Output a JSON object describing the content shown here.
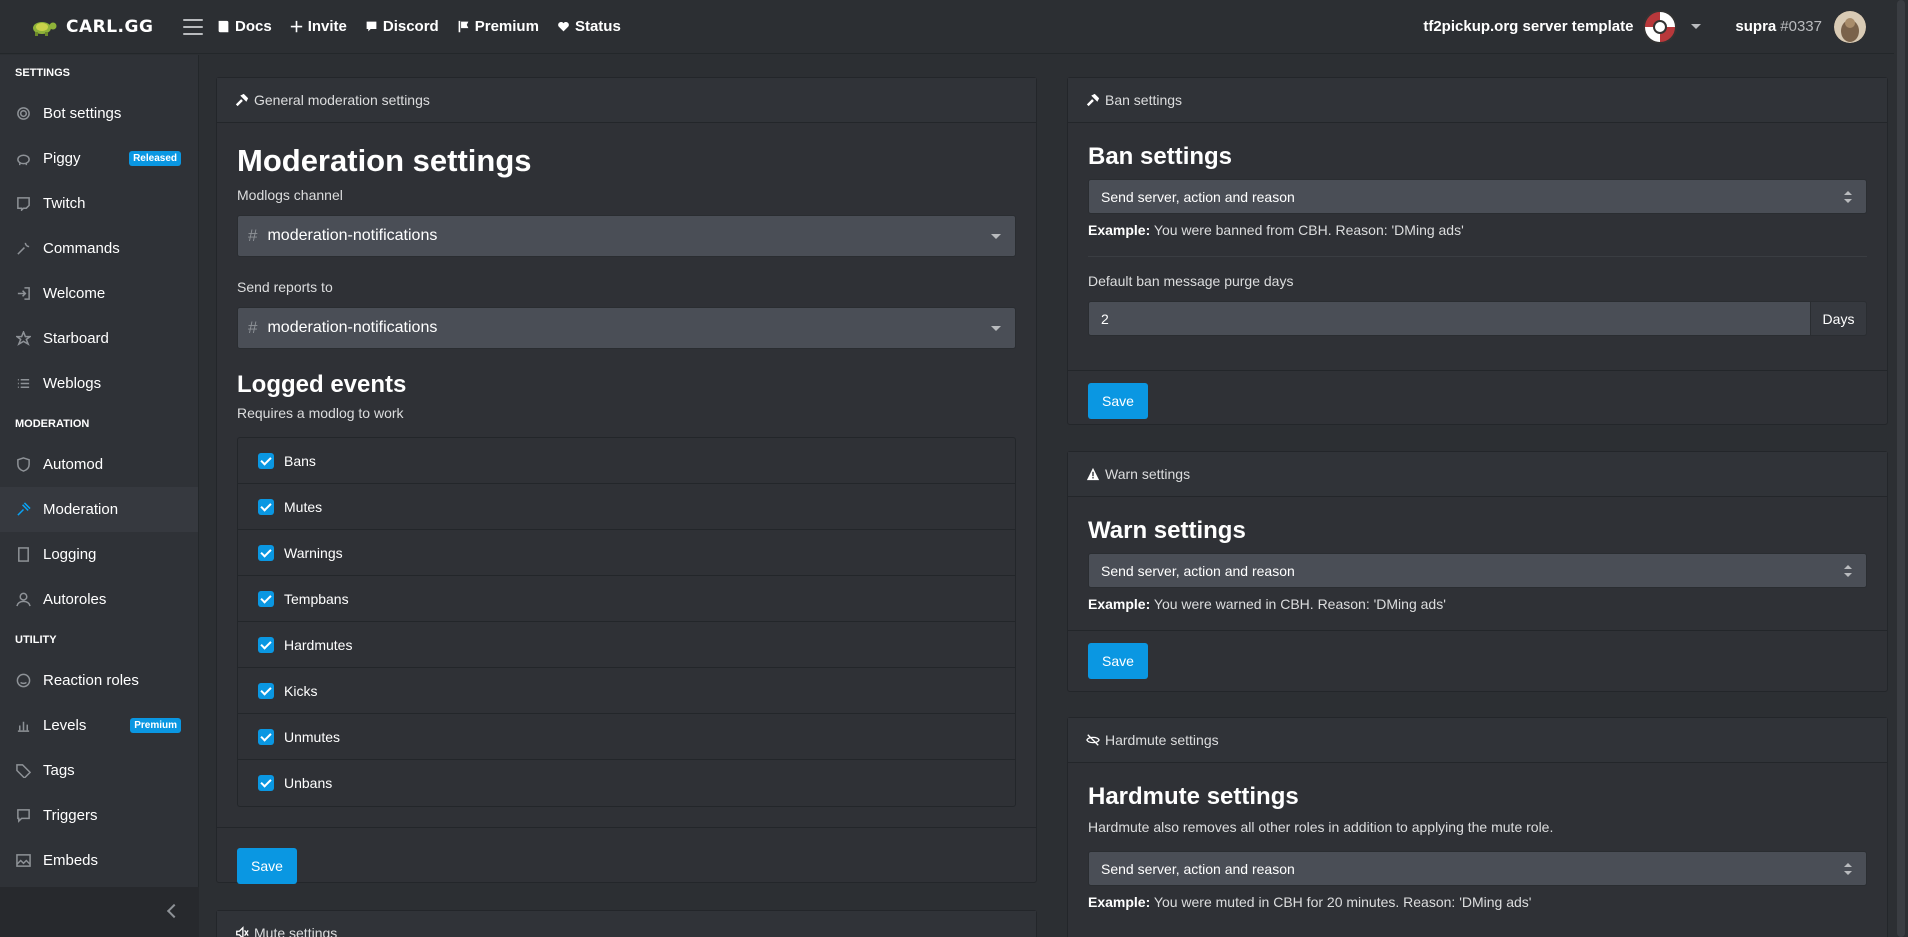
{
  "brand": {
    "name": "CARL.GG"
  },
  "topnav": [
    {
      "label": "Docs",
      "icon": "book-icon"
    },
    {
      "label": "Invite",
      "icon": "plus-icon"
    },
    {
      "label": "Discord",
      "icon": "discord-icon"
    },
    {
      "label": "Premium",
      "icon": "flag-icon"
    },
    {
      "label": "Status",
      "icon": "heart-icon"
    }
  ],
  "server": {
    "name": "tf2pickup.org server template"
  },
  "user": {
    "name": "supra",
    "discriminator": "#0337"
  },
  "sidebar": {
    "sections": [
      {
        "title": "SETTINGS",
        "items": [
          {
            "label": "Bot settings",
            "icon": "gear-icon"
          },
          {
            "label": "Piggy",
            "icon": "piggy-icon",
            "badge": "Released"
          },
          {
            "label": "Twitch",
            "icon": "twitch-icon"
          },
          {
            "label": "Commands",
            "icon": "wrench-icon"
          },
          {
            "label": "Welcome",
            "icon": "sign-in-icon"
          },
          {
            "label": "Starboard",
            "icon": "star-icon"
          },
          {
            "label": "Weblogs",
            "icon": "list-icon"
          }
        ]
      },
      {
        "title": "MODERATION",
        "items": [
          {
            "label": "Automod",
            "icon": "shield-icon"
          },
          {
            "label": "Moderation",
            "icon": "gavel-icon",
            "active": true
          },
          {
            "label": "Logging",
            "icon": "book-icon"
          },
          {
            "label": "Autoroles",
            "icon": "user-icon"
          }
        ]
      },
      {
        "title": "UTILITY",
        "items": [
          {
            "label": "Reaction roles",
            "icon": "smile-icon"
          },
          {
            "label": "Levels",
            "icon": "chart-icon",
            "badge": "Premium"
          },
          {
            "label": "Tags",
            "icon": "tag-icon"
          },
          {
            "label": "Triggers",
            "icon": "message-icon"
          },
          {
            "label": "Embeds",
            "icon": "image-icon"
          }
        ]
      }
    ]
  },
  "general": {
    "header": "General moderation settings",
    "title": "Moderation settings",
    "modlogs_label": "Modlogs channel",
    "modlogs_value": "moderation-notifications",
    "reports_label": "Send reports to",
    "reports_value": "moderation-notifications",
    "logged_title": "Logged events",
    "logged_sub": "Requires a modlog to work",
    "events": [
      "Bans",
      "Mutes",
      "Warnings",
      "Tempbans",
      "Hardmutes",
      "Kicks",
      "Unmutes",
      "Unbans"
    ],
    "save": "Save"
  },
  "mute": {
    "header": "Mute settings"
  },
  "ban": {
    "header": "Ban settings",
    "title": "Ban settings",
    "select": "Send server, action and reason",
    "example_label": "Example:",
    "example_text": "You were banned from CBH. Reason: 'DMing ads'",
    "purge_label": "Default ban message purge days",
    "purge_value": "2",
    "purge_unit": "Days",
    "save": "Save"
  },
  "warn": {
    "header": "Warn settings",
    "title": "Warn settings",
    "select": "Send server, action and reason",
    "example_label": "Example:",
    "example_text": "You were warned in CBH. Reason: 'DMing ads'",
    "save": "Save"
  },
  "hardmute": {
    "header": "Hardmute settings",
    "title": "Hardmute settings",
    "desc": "Hardmute also removes all other roles in addition to applying the mute role.",
    "select": "Send server, action and reason",
    "example_label": "Example:",
    "example_text": "You were muted in CBH for 20 minutes. Reason: 'DMing ads'"
  }
}
